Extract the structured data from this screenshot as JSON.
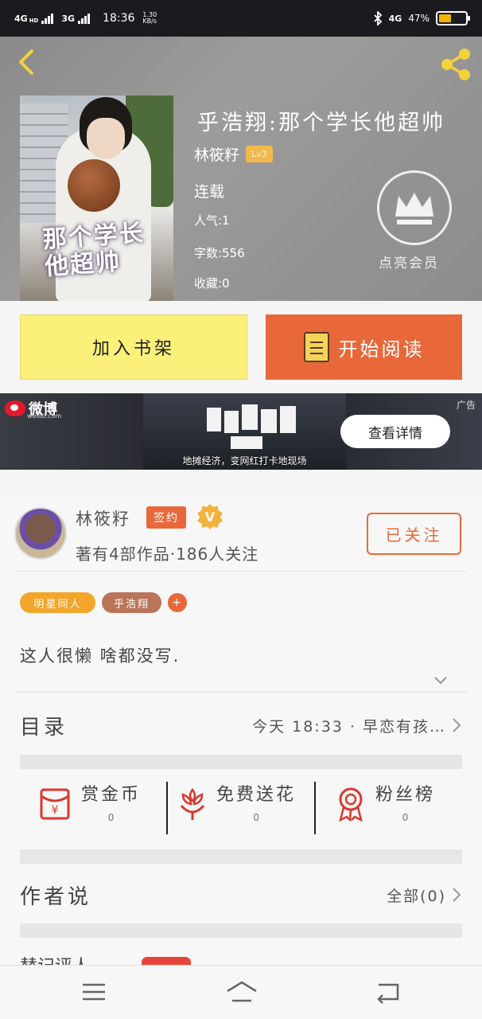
{
  "status_bar": {
    "net1": "4G",
    "net1_sup": "HD",
    "net2": "3G",
    "time": "18:36",
    "speed": "1.30",
    "speed_unit": "KB/s",
    "right_net": "4G",
    "battery_text": "47%",
    "battery_level": 0.47
  },
  "hero": {
    "book_title": "乎浩翔:那个学长他超帅",
    "author": "林筱籽",
    "level": "Lv3",
    "status": "连载",
    "popularity": "人气:1",
    "word_count": "字数:556",
    "favorites": "收藏:0",
    "vip_label": "点亮会员",
    "cover_art_text": "那个学长他超帅"
  },
  "actions": {
    "add_shelf": "加入书架",
    "start_read": "开始阅读"
  },
  "ad": {
    "brand": "微博",
    "brand_sub": "weibo.com",
    "caption": "地摊经济，变网红打卡地现场",
    "tag": "广告",
    "button": "查看详情"
  },
  "author_card": {
    "name": "林筱籽",
    "sign_badge": "签约",
    "v_badge": "V",
    "stats": "著有4部作品·186人关注",
    "follow_btn": "已关注",
    "tags": [
      "明星同人",
      "乎浩翔"
    ],
    "tag_add": "+",
    "intro": "这人很懒 啥都没写."
  },
  "catalog": {
    "title": "目录",
    "latest": "今天 18:33 · 早恋有孩…"
  },
  "gifts": [
    {
      "label": "赏金币",
      "count": "0",
      "icon": "red-envelope-icon"
    },
    {
      "label": "免费送花",
      "count": "0",
      "icon": "flower-icon"
    },
    {
      "label": "粉丝榜",
      "count": "0",
      "icon": "medal-icon"
    }
  ],
  "author_says": {
    "title": "作者说",
    "all": "全部(0)"
  },
  "partial_section": {
    "title": "替记评人"
  },
  "colors": {
    "accent": "#e8683a",
    "shelf_yellow": "#fbf07a",
    "tag_orange": "#f4a52c",
    "tag_brown": "#b9745a"
  }
}
